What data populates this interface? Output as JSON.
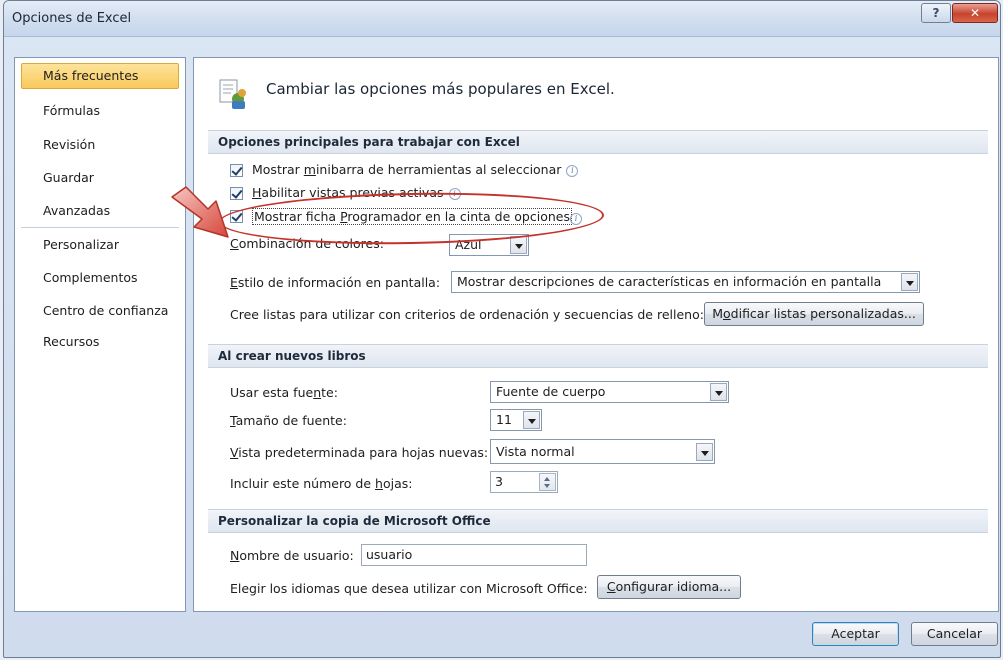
{
  "window": {
    "title": "Opciones de Excel"
  },
  "sidebar": {
    "items": [
      {
        "label": "Más frecuentes",
        "selected": true
      },
      {
        "label": "Fórmulas"
      },
      {
        "label": "Revisión"
      },
      {
        "label": "Guardar"
      },
      {
        "label": "Avanzadas"
      },
      {
        "label": "Personalizar"
      },
      {
        "label": "Complementos"
      },
      {
        "label": "Centro de confianza"
      },
      {
        "label": "Recursos"
      }
    ]
  },
  "header": {
    "text": "Cambiar las opciones más populares en Excel."
  },
  "sections": {
    "top": {
      "title": "Opciones principales para trabajar con Excel",
      "checkbox_1": {
        "pre": "Mostrar ",
        "accel": "m",
        "post": "inibarra de herramientas al seleccionar",
        "checked": true
      },
      "checkbox_2": {
        "pre": "",
        "accel": "H",
        "post": "abilitar vistas previas activas",
        "checked": true
      },
      "checkbox_3": {
        "pre": "Mostrar ficha ",
        "accel": "P",
        "post": "rogramador en la cinta de opciones",
        "checked": true
      },
      "color_scheme": {
        "accel": "C",
        "label_rest": "ombinación de colores:",
        "value": "Azul"
      },
      "screentip": {
        "accel": "E",
        "label_rest": "stilo de información en pantalla:",
        "value": "Mostrar descripciones de características en información en pantalla"
      },
      "custom_lists": {
        "label": "Cree listas para utilizar con criterios de ordenación y secuencias de relleno:",
        "button_accel": "o",
        "button_pre": "M",
        "button_post": "dificar listas personalizadas..."
      }
    },
    "new_books": {
      "title": "Al crear nuevos libros",
      "font": {
        "pre": "Usar esta fue",
        "accel": "n",
        "post": "te:",
        "value": "Fuente de cuerpo"
      },
      "size": {
        "accel": "T",
        "post": "amaño de fuente:",
        "value": "11"
      },
      "view": {
        "accel": "V",
        "post": "ista predeterminada para hojas nuevas:",
        "value": "Vista normal"
      },
      "sheets": {
        "pre": "Incluir este número de ",
        "accel": "h",
        "post": "ojas:",
        "value": "3"
      }
    },
    "office": {
      "title": "Personalizar la copia de Microsoft Office",
      "username": {
        "accel": "N",
        "post": "ombre de usuario:",
        "value": "usuario"
      },
      "languages": {
        "label": "Elegir los idiomas que desea utilizar con Microsoft Office:",
        "button_accel": "C",
        "button_post": "onfigurar idioma..."
      }
    }
  },
  "footer": {
    "ok": "Aceptar",
    "cancel": "Cancelar"
  },
  "annotation": {
    "color": "#c4322a"
  }
}
